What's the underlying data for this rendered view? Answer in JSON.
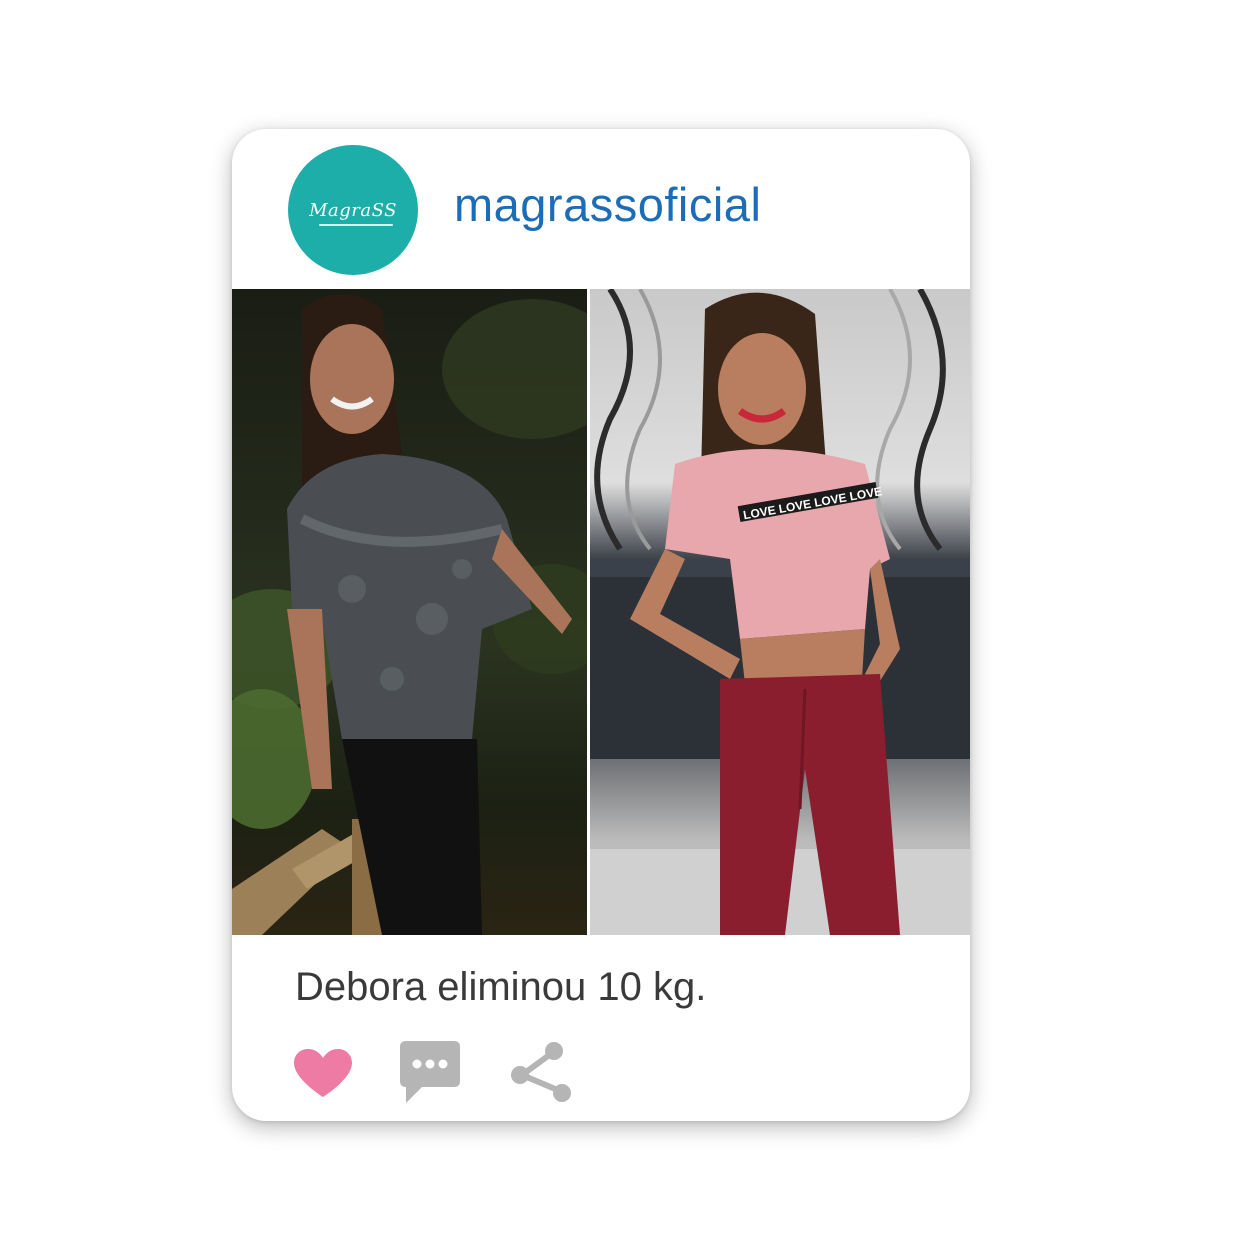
{
  "post": {
    "account": {
      "logo_text": "MagraSS",
      "username": "magrassoficial"
    },
    "caption": "Debora eliminou 10 kg.",
    "images": {
      "before": "before-photo",
      "after": "after-photo"
    },
    "shirt_print": "LOVE LOVE LOVE LOVE",
    "actions": {
      "like_icon": "heart-icon",
      "comment_icon": "speech-bubble-icon",
      "share_icon": "share-icon"
    }
  },
  "colors": {
    "avatar_bg": "#1eaeaa",
    "username": "#1d6db6",
    "caption": "#3a3a3a",
    "heart": "#ee7ba4",
    "icon_gray": "#b5b5b5"
  }
}
